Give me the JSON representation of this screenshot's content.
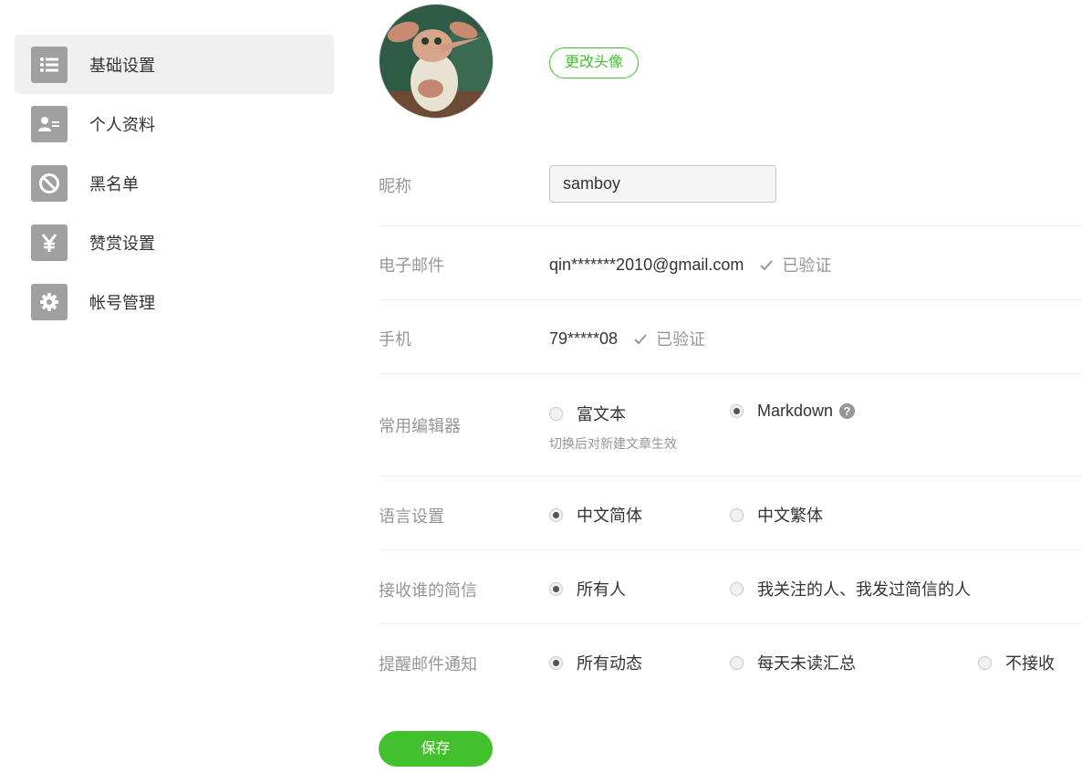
{
  "sidebar": {
    "items": [
      {
        "label": "基础设置",
        "icon": "list-icon",
        "active": true
      },
      {
        "label": "个人资料",
        "icon": "user-card-icon"
      },
      {
        "label": "黑名单",
        "icon": "block-icon"
      },
      {
        "label": "赞赏设置",
        "icon": "yen-icon"
      },
      {
        "label": "帐号管理",
        "icon": "gear-icon"
      }
    ]
  },
  "profile": {
    "change_avatar_label": "更改头像",
    "nickname_label": "昵称",
    "nickname_value": "samboy",
    "email_label": "电子邮件",
    "email_value": "qin*******2010@gmail.com",
    "email_status": "已验证",
    "phone_label": "手机",
    "phone_value": "79*****08",
    "phone_status": "已验证"
  },
  "editor": {
    "label": "常用编辑器",
    "options": [
      "富文本",
      "Markdown"
    ],
    "selected": "Markdown",
    "hint": "切换后对新建文章生效",
    "help_glyph": "?"
  },
  "language": {
    "label": "语言设置",
    "options": [
      "中文简体",
      "中文繁体"
    ],
    "selected": "中文简体"
  },
  "messages": {
    "label": "接收谁的简信",
    "options": [
      "所有人",
      "我关注的人、我发过简信的人"
    ],
    "selected": "所有人"
  },
  "email_notify": {
    "label": "提醒邮件通知",
    "options": [
      "所有动态",
      "每天未读汇总",
      "不接收"
    ],
    "selected": "所有动态"
  },
  "save_label": "保存",
  "colors": {
    "accent": "#42c02e",
    "icon_bg": "#a0a0a0",
    "muted": "#969696"
  }
}
